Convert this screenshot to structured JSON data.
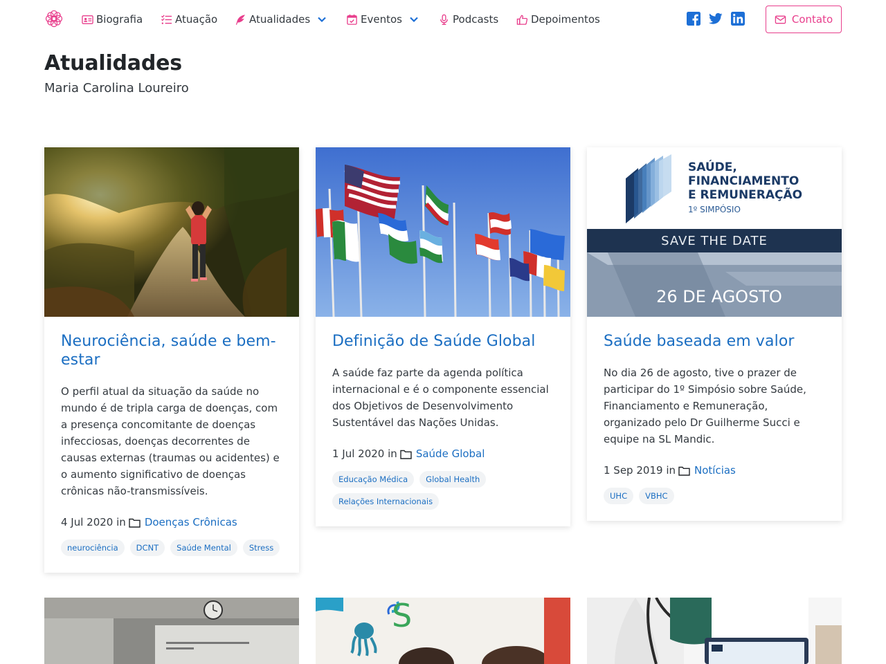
{
  "nav": {
    "items": [
      {
        "label": "Biografia"
      },
      {
        "label": "Atuação"
      },
      {
        "label": "Atualidades"
      },
      {
        "label": "Eventos"
      },
      {
        "label": "Podcasts"
      },
      {
        "label": "Depoimentos"
      }
    ],
    "contact_label": "Contato"
  },
  "header": {
    "title": "Atualidades",
    "subtitle": "Maria Carolina Loureiro"
  },
  "posts": [
    {
      "title": "Neurociência, saúde e bem-estar",
      "excerpt": "O perfil atual da situação da saúde no mundo é de tripla carga de doenças, com a presença concomitante de doenças infecciosas, doenças decorrentes de causas externas (traumas ou acidentes) e o aumento significativo de doenças crônicas não-transmissíveis.",
      "date": "4 Jul 2020",
      "in": "in",
      "category": "Doenças Crônicas",
      "tags": [
        "neurociência",
        "DCNT",
        "Saúde Mental",
        "Stress"
      ]
    },
    {
      "title": "Definição de Saúde Global",
      "excerpt": "A saúde faz parte da agenda política internacional e é o componente essencial dos Objetivos de Desenvolvimento Sustentável das Nações Unidas.",
      "date": "1 Jul 2020",
      "in": "in",
      "category": "Saúde Global",
      "tags": [
        "Educação Médica",
        "Global Health",
        "Relações Internacionais"
      ]
    },
    {
      "title": "Saúde baseada em valor",
      "excerpt": "No dia 26 de agosto, tive o prazer de participar do 1º Simpósio sobre Saúde, Financiamento e Remuneração, organizado pelo Dr Guilherme Succi e equipe na SL Mandic.",
      "date": "1 Sep 2019",
      "in": "in",
      "category": "Notícias",
      "tags": [
        "UHC",
        "VBHC"
      ],
      "banner": {
        "line1": "SAÚDE,",
        "line2": "FINANCIAMENTO",
        "line3": "E REMUNERAÇÃO",
        "line4": "1º SIMPÓSIO",
        "save": "SAVE THE DATE",
        "date": "26 DE AGOSTO"
      }
    }
  ],
  "colors": {
    "accent": "#e83e8c",
    "link": "#1b6ec2",
    "social": "#1d6fd6"
  }
}
